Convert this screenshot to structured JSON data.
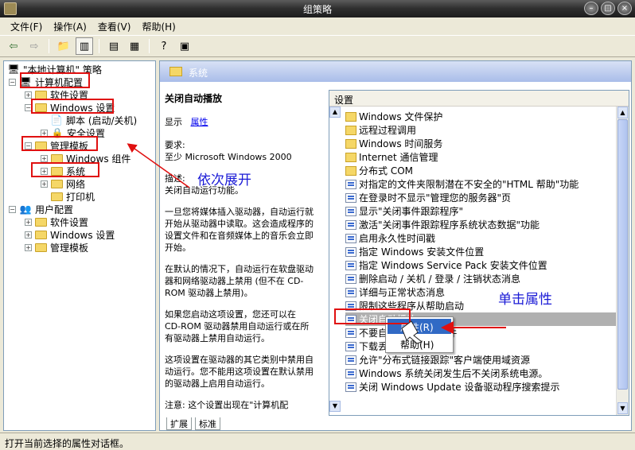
{
  "window": {
    "title": "组策略"
  },
  "menubar": [
    "文件(F)",
    "操作(A)",
    "查看(V)",
    "帮助(H)"
  ],
  "tree": {
    "root": "\"本地计算机\" 策略",
    "items": [
      {
        "label": "计算机配置",
        "level": 1
      },
      {
        "label": "软件设置",
        "level": 2
      },
      {
        "label": "Windows 设置",
        "level": 2
      },
      {
        "label": "脚本 (启动/关机)",
        "level": 3
      },
      {
        "label": "安全设置",
        "level": 3
      },
      {
        "label": "管理模板",
        "level": 2
      },
      {
        "label": "Windows 组件",
        "level": 3
      },
      {
        "label": "系统",
        "level": 3
      },
      {
        "label": "网络",
        "level": 3
      },
      {
        "label": "打印机",
        "level": 3
      },
      {
        "label": "用户配置",
        "level": 1
      },
      {
        "label": "软件设置",
        "level": 2
      },
      {
        "label": "Windows 设置",
        "level": 2
      },
      {
        "label": "管理模板",
        "level": 2
      }
    ]
  },
  "main": {
    "header_title": "系统",
    "description": {
      "title": "关闭自动播放",
      "show_label": "显示",
      "properties_link": "属性",
      "requirement_label": "要求:",
      "requirement_value": "至少 Microsoft Windows 2000",
      "desc_label": "描述:",
      "desc_text": "关闭自动运行功能。",
      "para1": "一旦您将媒体插入驱动器，自动运行就开始从驱动器中读取。这会造成程序的设置文件和在音频媒体上的音乐会立即开始。",
      "para2": "在默认的情况下，自动运行在软盘驱动器和网络驱动器上禁用 (但不在 CD-ROM 驱动器上禁用)。",
      "para3": "如果您启动这项设置，您还可以在 CD-ROM 驱动器禁用自动运行或在所有驱动器上禁用自动运行。",
      "para4": "这项设置在驱动器的其它类别中禁用自动运行。您不能用这项设置在默认禁用的驱动器上启用自动运行。",
      "para5": "注意: 这个设置出现在\"计算机配"
    },
    "list_header": "设置",
    "list": [
      {
        "label": "Windows 文件保护",
        "type": "folder"
      },
      {
        "label": "远程过程调用",
        "type": "folder"
      },
      {
        "label": "Windows 时间服务",
        "type": "folder"
      },
      {
        "label": "Internet 通信管理",
        "type": "folder"
      },
      {
        "label": "分布式 COM",
        "type": "folder"
      },
      {
        "label": "对指定的文件夹限制潜在不安全的\"HTML 帮助\"功能",
        "type": "policy"
      },
      {
        "label": "在登录时不显示\"管理您的服务器\"页",
        "type": "policy"
      },
      {
        "label": "显示\"关闭事件跟踪程序\"",
        "type": "policy"
      },
      {
        "label": "激活\"关闭事件跟踪程序系统状态数据\"功能",
        "type": "policy"
      },
      {
        "label": "启用永久性时间戳",
        "type": "policy"
      },
      {
        "label": "指定 Windows 安装文件位置",
        "type": "policy"
      },
      {
        "label": "指定 Windows Service Pack 安装文件位置",
        "type": "policy"
      },
      {
        "label": "删除启动 / 关机 / 登录 / 注销状态消息",
        "type": "policy"
      },
      {
        "label": "详细与正常状态消息",
        "type": "policy"
      },
      {
        "label": "限制这些程序从帮助启动",
        "type": "policy"
      },
      {
        "label": "关闭自动播放",
        "type": "policy",
        "selected": true
      },
      {
        "label": "不要自动...                    夹中的文件",
        "type": "policy"
      },
      {
        "label": "下载丢失...",
        "type": "policy"
      },
      {
        "label": "允许\"分布式链接跟踪\"客户端使用域资源",
        "type": "policy"
      },
      {
        "label": "Windows 系统关闭发生后不关闭系统电源。",
        "type": "policy"
      },
      {
        "label": "关闭 Windows Update 设备驱动程序搜索提示",
        "type": "policy"
      }
    ],
    "tabs": [
      "扩展",
      "标准"
    ]
  },
  "context_menu": [
    "属性(R)",
    "帮助(H)"
  ],
  "annotations": {
    "expand": "依次展开",
    "click_props": "单击属性"
  },
  "statusbar": "打开当前选择的属性对话框。",
  "colors": {
    "highlight": "#316ac5",
    "annotation_red": "#e01010",
    "annotation_blue": "#1a1ad6"
  }
}
